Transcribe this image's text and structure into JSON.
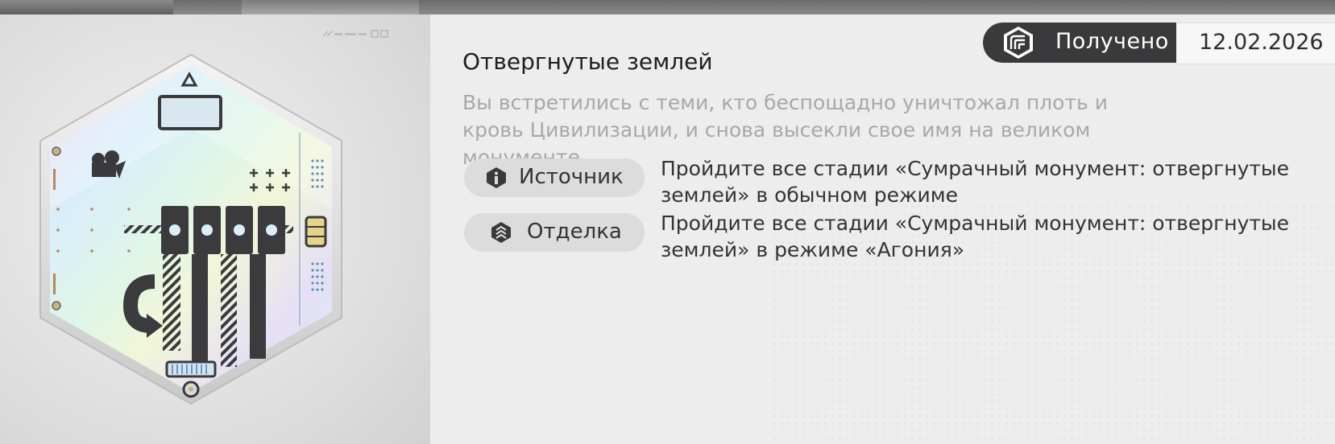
{
  "header": {
    "status_label": "Получено",
    "date": "12.02.2026"
  },
  "item": {
    "title": "Отвергнутые землей",
    "description": "Вы встретились с теми, кто беспощадно уничтожал плоть и кровь Цивилизации, и снова высекли свое имя на великом монументе."
  },
  "rows": [
    {
      "chip_label": "Источник",
      "icon": "info-icon",
      "text": "Пройдите все стадии «Сумрачный монумент: отвергнутые землей» в обычном режиме"
    },
    {
      "chip_label": "Отделка",
      "icon": "finish-icon",
      "text": "Пройдите все стадии «Сумрачный монумент: отвергнутые землей» в режиме «Агония»"
    }
  ],
  "colors": {
    "accent_dark": "#3a3a3c",
    "background": "#ededed",
    "muted_text": "#a8a8a8"
  }
}
